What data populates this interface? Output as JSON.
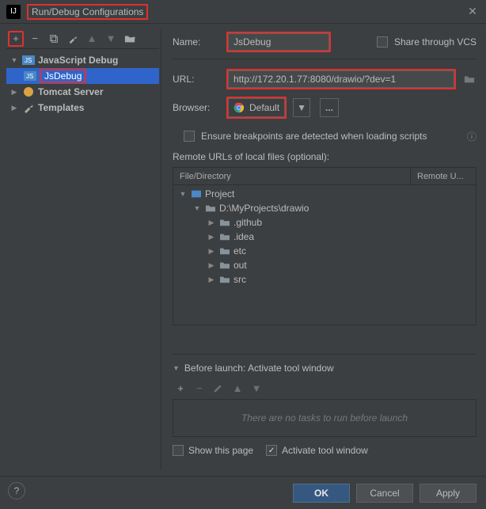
{
  "window": {
    "title": "Run/Debug Configurations",
    "appicon": "IJ"
  },
  "toolbar": {
    "add": "+",
    "remove": "−",
    "copy": "⿻",
    "wrench": "🔧",
    "up": "▲",
    "down": "▼",
    "folder": "📁"
  },
  "tree": {
    "root": {
      "label": "JavaScript Debug"
    },
    "child": {
      "label": "JsDebug"
    },
    "tomcat": {
      "label": "Tomcat Server"
    },
    "templates": {
      "label": "Templates"
    }
  },
  "form": {
    "name_label": "Name:",
    "name_value": "JsDebug",
    "share_label": "Share through VCS",
    "url_label": "URL:",
    "url_value": "http://172.20.1.77:8080/drawio/?dev=1",
    "browser_label": "Browser:",
    "browser_value": "Default",
    "ensure_label": "Ensure breakpoints are detected when loading scripts",
    "remote_label": "Remote URLs of local files (optional):"
  },
  "filetree": {
    "col_file": "File/Directory",
    "col_remote": "Remote U...",
    "root": "Project",
    "path": "D:\\MyProjects\\drawio",
    "dirs": [
      ".github",
      ".idea",
      "etc",
      "out",
      "src"
    ]
  },
  "before": {
    "title": "Before launch: Activate tool window",
    "empty": "There are no tasks to run before launch",
    "show_label": "Show this page",
    "activate_label": "Activate tool window"
  },
  "footer": {
    "ok": "OK",
    "cancel": "Cancel",
    "apply": "Apply",
    "help": "?"
  }
}
